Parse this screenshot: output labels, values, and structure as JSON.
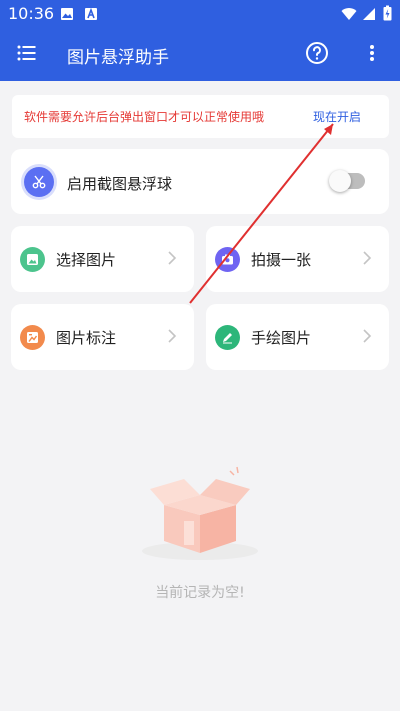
{
  "status_bar": {
    "time": "10:36"
  },
  "app_bar": {
    "title": "图片悬浮助手"
  },
  "notice": {
    "message": "软件需要允许后台弹出窗口才可以正常使用哦",
    "action": "现在开启"
  },
  "float_ball": {
    "label": "启用截图悬浮球",
    "enabled": false
  },
  "tiles": [
    {
      "label": "选择图片",
      "icon": "image-icon",
      "color": "#4cc48d"
    },
    {
      "label": "拍摄一张",
      "icon": "camera-icon",
      "color": "#6f64f2"
    },
    {
      "label": "图片标注",
      "icon": "annotate-icon",
      "color": "#f28a4c"
    },
    {
      "label": "手绘图片",
      "icon": "pen-icon",
      "color": "#2db67a"
    }
  ],
  "empty_state": {
    "text": "当前记录为空!"
  },
  "colors": {
    "primary": "#2f5fe0",
    "warning": "#e53935",
    "arrow": "#e03030"
  }
}
